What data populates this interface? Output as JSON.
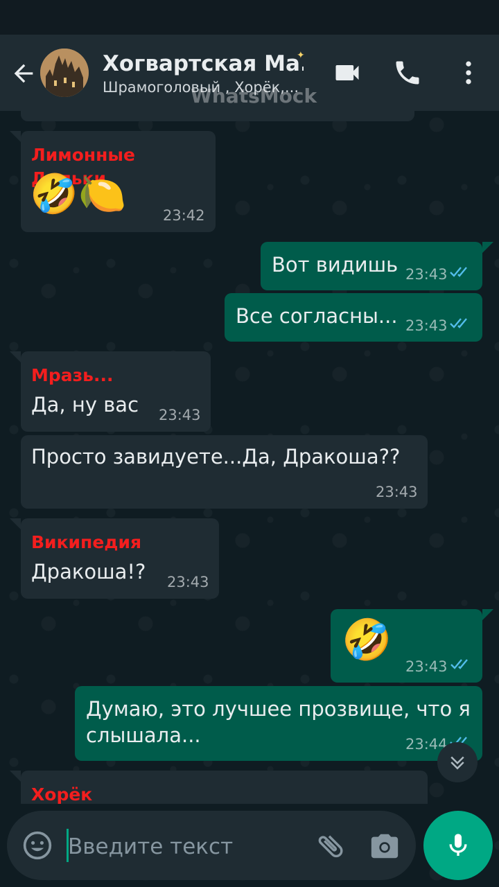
{
  "header": {
    "title": "Хогвартская Ма...",
    "subtitle": "Шрамоголовый , Хорёк,...",
    "watermark": "WhatsMock",
    "icons": [
      "back-arrow-icon",
      "video-call-icon",
      "phone-icon",
      "more-vert-icon"
    ]
  },
  "messages": [
    {
      "type": "in",
      "sender": "Лимонные Дольки",
      "emoji": "🤣🍋",
      "time": "23:42"
    },
    {
      "type": "out",
      "text": "Вот видишь",
      "time": "23:43",
      "status": "read"
    },
    {
      "type": "out",
      "text": "Все согласны...",
      "time": "23:43",
      "status": "read"
    },
    {
      "type": "in",
      "sender": "Мразь...",
      "text": "Да, ну вас",
      "time": "23:43"
    },
    {
      "type": "in",
      "text": "Просто завидуете...Да, Дракоша??",
      "time": "23:43"
    },
    {
      "type": "in",
      "sender": "Википедия",
      "text": "Дракоша!?",
      "time": "23:43"
    },
    {
      "type": "out",
      "emoji": "🤣",
      "time": "23:43",
      "status": "read"
    },
    {
      "type": "out",
      "text_line1": "Думаю, это лучшее прозвище, что я",
      "text_line2": "слышала...",
      "time": "23:44",
      "status": "read"
    },
    {
      "type": "in",
      "sender": "Хорёк"
    }
  ],
  "input": {
    "placeholder": "Введите текст"
  },
  "colors": {
    "sender": "#f31e1e",
    "accent": "#00a884",
    "tick_read": "#53bdeb"
  }
}
